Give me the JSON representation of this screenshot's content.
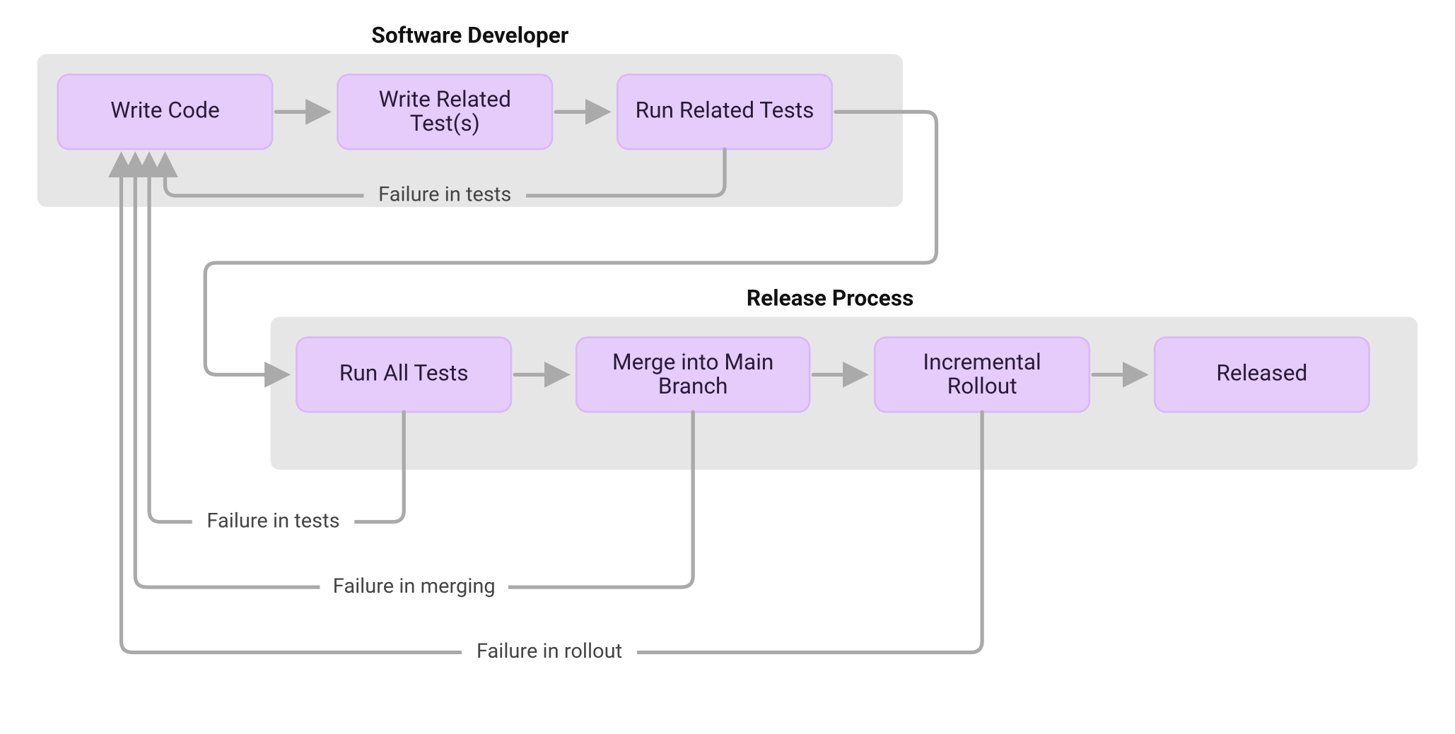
{
  "groups": {
    "developer": {
      "title": "Software Developer"
    },
    "release": {
      "title": "Release Process"
    }
  },
  "nodes": {
    "write_code": {
      "label": "Write Code"
    },
    "write_tests": {
      "label1": "Write Related",
      "label2": "Test(s)"
    },
    "run_related_tests": {
      "label": "Run Related Tests"
    },
    "run_all_tests": {
      "label": "Run All Tests"
    },
    "merge_main": {
      "label1": "Merge into Main",
      "label2": "Branch"
    },
    "incremental": {
      "label1": "Incremental",
      "label2": "Rollout"
    },
    "released": {
      "label": "Released"
    }
  },
  "edges": {
    "fail_related": {
      "label": "Failure in tests"
    },
    "fail_all": {
      "label": "Failure in tests"
    },
    "fail_merge": {
      "label": "Failure in merging"
    },
    "fail_rollout": {
      "label": "Failure in rollout"
    }
  }
}
